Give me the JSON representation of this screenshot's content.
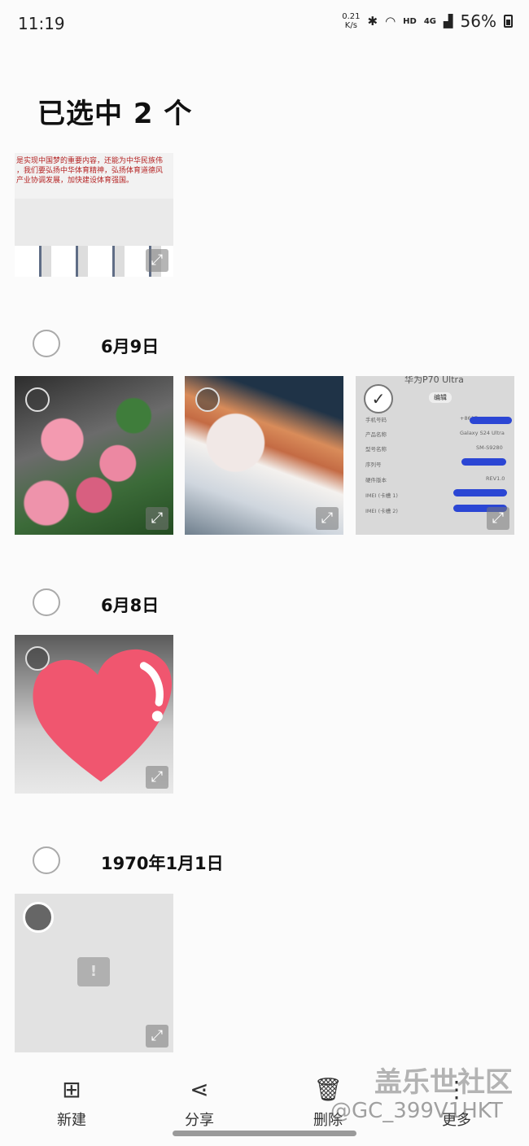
{
  "status_bar": {
    "time": "11:19",
    "net_speed_value": "0.21",
    "net_speed_unit": "K/s",
    "hd": "HD",
    "network": "4G",
    "battery": "56%"
  },
  "header": {
    "title": "已选中 2 个"
  },
  "top_image": {
    "banner_lines": [
      "是实现中国梦的重要内容，还能为中华民族伟",
      "，我们要弘扬中华体育精神，弘扬体育道德风",
      "产业协调发展，加快建设体育强国。"
    ]
  },
  "groups": [
    {
      "date": "6月9日"
    },
    {
      "date": "6月8日"
    },
    {
      "date": "1970年1月1日"
    }
  ],
  "phone_screenshot": {
    "heading": "华为P70 Ultra",
    "edit": "编辑",
    "rows": [
      {
        "label": "手机号码",
        "value": "+8617"
      },
      {
        "label": "产品名称",
        "value": "Galaxy S24 Ultra"
      },
      {
        "label": "型号名称",
        "value": "SM-S9280"
      },
      {
        "label": "序列号",
        "value": ""
      },
      {
        "label": "硬件版本",
        "value": "REV1.0"
      },
      {
        "label": "IMEI (卡槽 1)",
        "value": ""
      },
      {
        "label": "IMEI (卡槽 2)",
        "value": ""
      }
    ]
  },
  "toolbar": {
    "new_label": "新建",
    "share_label": "分享",
    "delete_label": "删除",
    "more_label": "更多"
  },
  "watermark": {
    "line1": "盖乐世社区",
    "line2": "@GC_399V1HKT"
  },
  "icons": {
    "expand": "expand-icon",
    "checkmark": "checkmark-icon",
    "new": "new-video-icon",
    "share": "share-icon",
    "delete": "trash-icon",
    "more": "more-icon"
  }
}
